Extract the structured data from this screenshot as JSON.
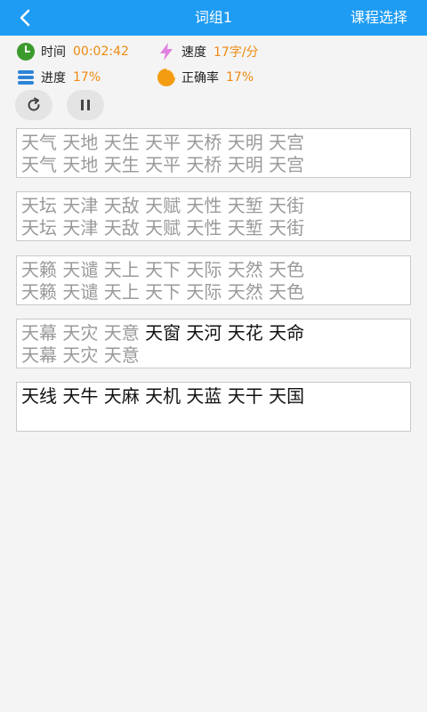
{
  "header": {
    "title": "词组1",
    "course_label": "课程选择"
  },
  "stats": {
    "time": {
      "label": "时间",
      "value": "00:02:42"
    },
    "speed": {
      "label": "速度",
      "value": "17字/分"
    },
    "progress": {
      "label": "进度",
      "value": "17%"
    },
    "accuracy": {
      "label": "正确率",
      "value": "17%",
      "fraction": 0.17
    }
  },
  "colors": {
    "accent": "#1e9cf4",
    "value": "#ee8a10",
    "typed": "#9a9a9a",
    "pending": "#111111"
  },
  "icons": {
    "back": "chevron-left-icon",
    "time": "clock-icon",
    "speed": "lightning-icon",
    "progress": "list-icon",
    "accuracy": "pie-icon",
    "reload": "reload-icon",
    "pause": "pause-icon"
  },
  "groups": [
    {
      "line1_done": "天气 天地 天生 天平 天桥 天明 天宫",
      "line1_todo": "",
      "line2": "天气 天地 天生 天平 天桥 天明 天宫"
    },
    {
      "line1_done": "天坛 天津 天敌 天赋 天性 天堑 天街",
      "line1_todo": "",
      "line2": "天坛 天津 天敌 天赋 天性 天堑 天街"
    },
    {
      "line1_done": "天籁 天谴 天上 天下 天际 天然 天色",
      "line1_todo": "",
      "line2": "天籁 天谴 天上 天下 天际 天然 天色"
    },
    {
      "line1_done": "天幕 天灾 天意 ",
      "line1_todo": "天窗 天河 天花 天命",
      "line2": "天幕 天灾 天意"
    },
    {
      "line1_done": "",
      "line1_todo": "天线 天牛 天麻 天机 天蓝 天干 天国",
      "line2": ""
    }
  ]
}
